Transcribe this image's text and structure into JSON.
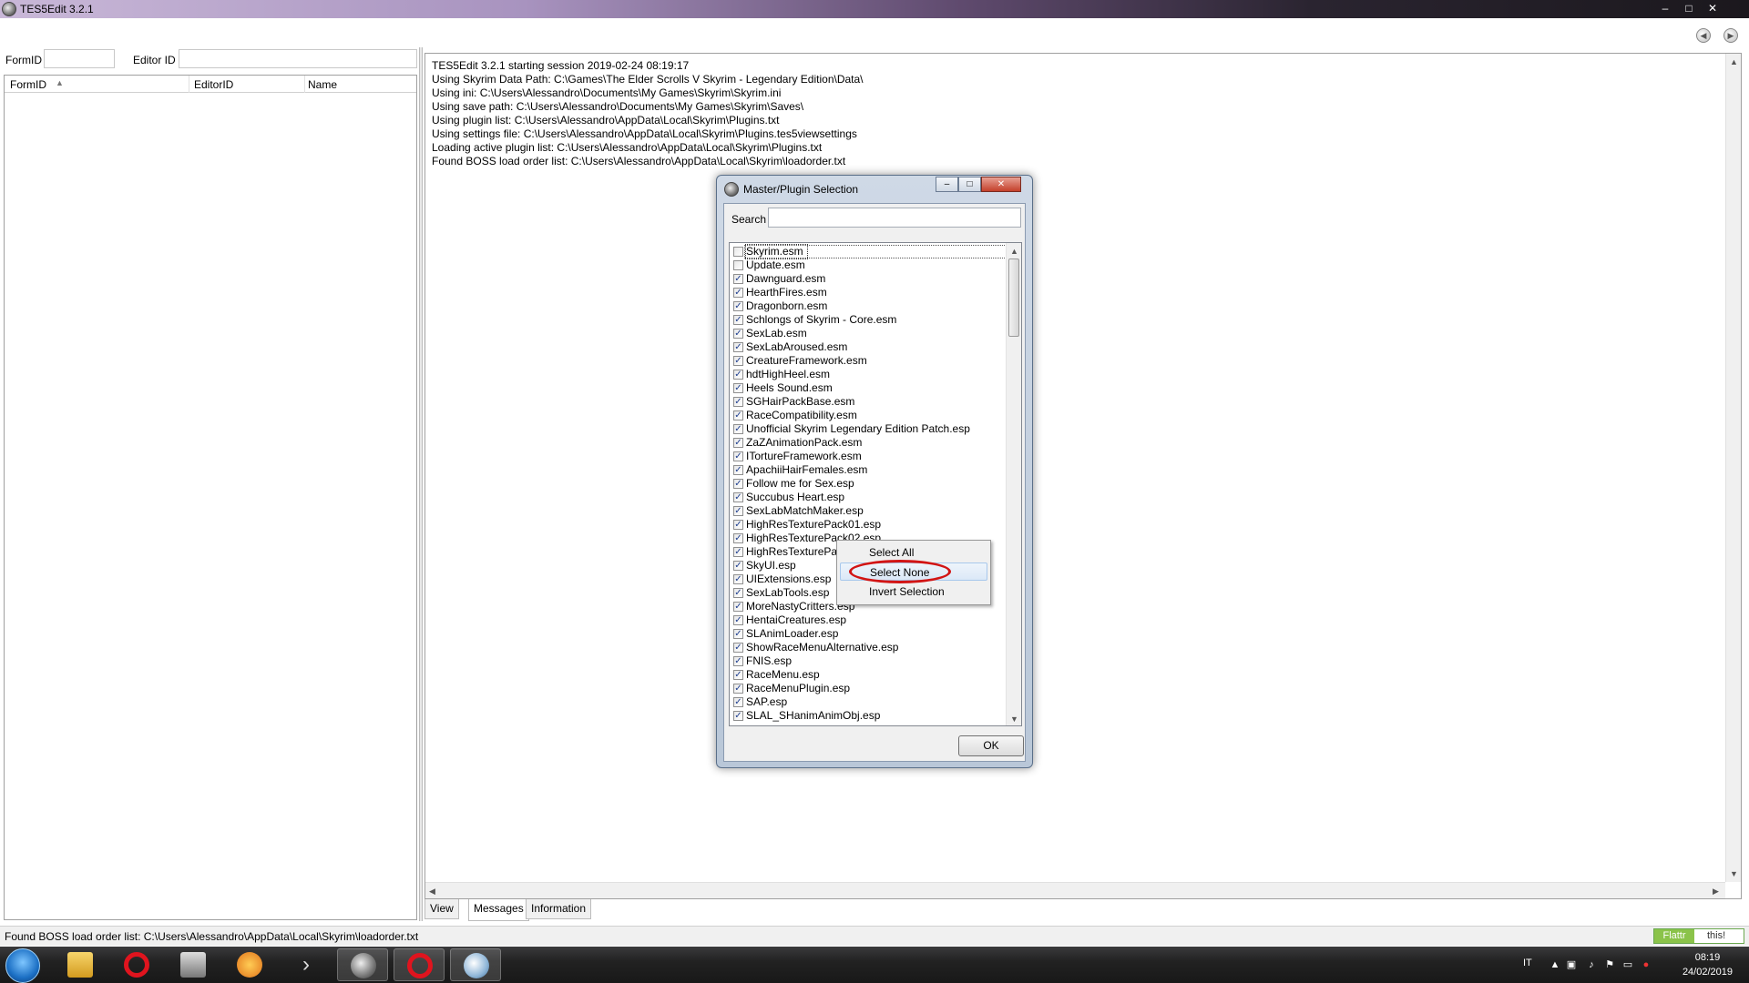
{
  "window": {
    "title": "TES5Edit 3.2.1",
    "controls": [
      "–",
      "□",
      "✕"
    ]
  },
  "toolbar": {
    "formid_label": "FormID",
    "editorid_label": "Editor ID",
    "formid_value": "",
    "editorid_value": ""
  },
  "tree": {
    "columns": [
      "FormID",
      "EditorID",
      "Name"
    ],
    "sort_indicator": "▲"
  },
  "messages": [
    "TES5Edit 3.2.1 starting session 2019-02-24 08:19:17",
    "Using Skyrim Data Path: C:\\Games\\The Elder Scrolls V Skyrim - Legendary Edition\\Data\\",
    "Using ini: C:\\Users\\Alessandro\\Documents\\My Games\\Skyrim\\Skyrim.ini",
    "Using save path: C:\\Users\\Alessandro\\Documents\\My Games\\Skyrim\\Saves\\",
    "Using plugin list: C:\\Users\\Alessandro\\AppData\\Local\\Skyrim\\Plugins.txt",
    "Using settings file: C:\\Users\\Alessandro\\AppData\\Local\\Skyrim\\Plugins.tes5viewsettings",
    "Loading active plugin list: C:\\Users\\Alessandro\\AppData\\Local\\Skyrim\\Plugins.txt",
    "Found BOSS load order list: C:\\Users\\Alessandro\\AppData\\Local\\Skyrim\\loadorder.txt"
  ],
  "tabs": [
    "View",
    "Messages",
    "Information"
  ],
  "active_tab": "Messages",
  "status_text": "Found BOSS load order list: C:\\Users\\Alessandro\\AppData\\Local\\Skyrim\\loadorder.txt",
  "flattr": {
    "left": "Flattr",
    "right": "this!"
  },
  "dialog": {
    "title": "Master/Plugin Selection",
    "search_label": "Search",
    "search_value": "",
    "ok_label": "OK",
    "plugins": [
      {
        "name": "Skyrim.esm",
        "checked": false,
        "focused": true
      },
      {
        "name": "Update.esm",
        "checked": false
      },
      {
        "name": "Dawnguard.esm",
        "checked": true
      },
      {
        "name": "HearthFires.esm",
        "checked": true
      },
      {
        "name": "Dragonborn.esm",
        "checked": true
      },
      {
        "name": "Schlongs of Skyrim - Core.esm",
        "checked": true
      },
      {
        "name": "SexLab.esm",
        "checked": true
      },
      {
        "name": "SexLabAroused.esm",
        "checked": true
      },
      {
        "name": "CreatureFramework.esm",
        "checked": true
      },
      {
        "name": "hdtHighHeel.esm",
        "checked": true
      },
      {
        "name": "Heels Sound.esm",
        "checked": true
      },
      {
        "name": "SGHairPackBase.esm",
        "checked": true
      },
      {
        "name": "RaceCompatibility.esm",
        "checked": true
      },
      {
        "name": "Unofficial Skyrim Legendary Edition Patch.esp",
        "checked": true
      },
      {
        "name": "ZaZAnimationPack.esm",
        "checked": true
      },
      {
        "name": "ITortureFramework.esm",
        "checked": true
      },
      {
        "name": "ApachiiHairFemales.esm",
        "checked": true
      },
      {
        "name": "Follow me for Sex.esp",
        "checked": true
      },
      {
        "name": "Succubus Heart.esp",
        "checked": true
      },
      {
        "name": "SexLabMatchMaker.esp",
        "checked": true
      },
      {
        "name": "HighResTexturePack01.esp",
        "checked": true
      },
      {
        "name": "HighResTexturePack02.esp",
        "checked": true
      },
      {
        "name": "HighResTexturePac",
        "checked": true
      },
      {
        "name": "SkyUI.esp",
        "checked": true
      },
      {
        "name": "UIExtensions.esp",
        "checked": true
      },
      {
        "name": "SexLabTools.esp",
        "checked": true
      },
      {
        "name": "MoreNastyCritters.esp",
        "checked": true
      },
      {
        "name": "HentaiCreatures.esp",
        "checked": true
      },
      {
        "name": "SLAnimLoader.esp",
        "checked": true
      },
      {
        "name": "ShowRaceMenuAlternative.esp",
        "checked": true
      },
      {
        "name": "FNIS.esp",
        "checked": true
      },
      {
        "name": "RaceMenu.esp",
        "checked": true
      },
      {
        "name": "RaceMenuPlugin.esp",
        "checked": true
      },
      {
        "name": "SAP.esp",
        "checked": true
      },
      {
        "name": "SLAL_SHanimAnimObj.esp",
        "checked": true
      }
    ]
  },
  "context_menu": {
    "items": [
      "Select All",
      "Select None",
      "Invert Selection"
    ],
    "highlighted": "Select None"
  },
  "taskbar": {
    "language": "IT",
    "time": "08:19",
    "date": "24/02/2019"
  },
  "colors": {
    "highlight_circle": "#d21414",
    "flattr_green": "#8bc34a"
  }
}
